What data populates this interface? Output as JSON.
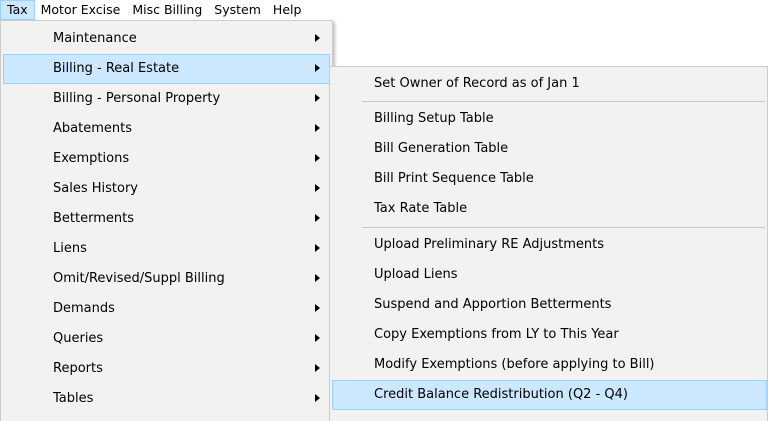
{
  "menubar": {
    "items": [
      "Tax",
      "Motor Excise",
      "Misc Billing",
      "System",
      "Help"
    ]
  },
  "tax_menu": {
    "items": [
      "Maintenance",
      "Billing - Real Estate",
      "Billing - Personal Property",
      "Abatements",
      "Exemptions",
      "Sales History",
      "Betterments",
      "Liens",
      "Omit/Revised/Suppl Billing",
      "Demands",
      "Queries",
      "Reports",
      "Tables"
    ]
  },
  "billing_re_submenu": {
    "items": [
      "Set Owner of Record as of Jan 1",
      "Billing Setup Table",
      "Bill Generation Table",
      "Bill Print Sequence Table",
      "Tax Rate Table",
      "Upload Preliminary RE Adjustments",
      "Upload Liens",
      "Suspend and Apportion Betterments",
      "Copy Exemptions from LY to This Year",
      "Modify Exemptions (before applying to Bill)",
      "Credit Balance Redistribution (Q2 - Q4)"
    ]
  },
  "colors": {
    "highlight_bg": "#cce8ff",
    "highlight_border": "#99d1ff",
    "menu_bg": "#f2f2f2"
  }
}
